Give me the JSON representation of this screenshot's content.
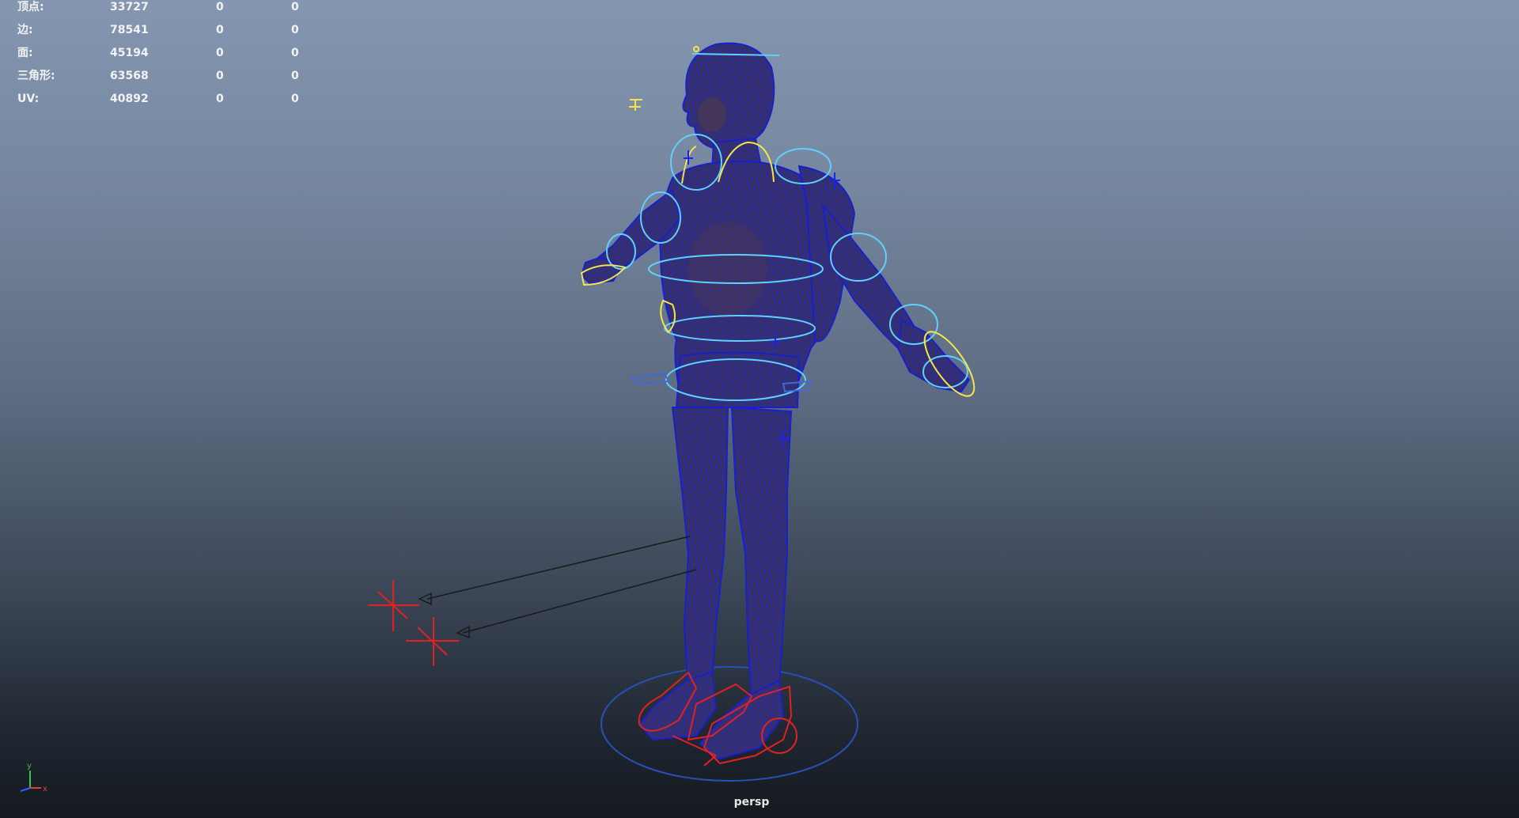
{
  "hud": {
    "rows": [
      {
        "label": "顶点:",
        "v1": "33727",
        "v2": "0",
        "v3": "0"
      },
      {
        "label": "边:",
        "v1": "78541",
        "v2": "0",
        "v3": "0"
      },
      {
        "label": "面:",
        "v1": "45194",
        "v2": "0",
        "v3": "0"
      },
      {
        "label": "三角形:",
        "v1": "63568",
        "v2": "0",
        "v3": "0"
      },
      {
        "label": "UV:",
        "v1": "40892",
        "v2": "0",
        "v3": "0"
      }
    ]
  },
  "viewport": {
    "camera": "persp"
  },
  "axis": {
    "y_label": "y",
    "x_label": "x",
    "colors": {
      "x": "#e0402a",
      "y": "#38c24a",
      "z": "#3a5cff"
    }
  },
  "colors": {
    "mesh_fill": "#3a3258",
    "wireframe": "#1a2adb",
    "control_cyan": "#5fd0ff",
    "control_yellow": "#f2e64a",
    "control_red": "#e02222",
    "text": "#f3f3f3"
  },
  "scene_icons": [
    "character-wireframe-mesh",
    "cyan-control-curves",
    "yellow-control-curves",
    "red-foot-controls",
    "ground-circle",
    "pole-vector-locators"
  ]
}
